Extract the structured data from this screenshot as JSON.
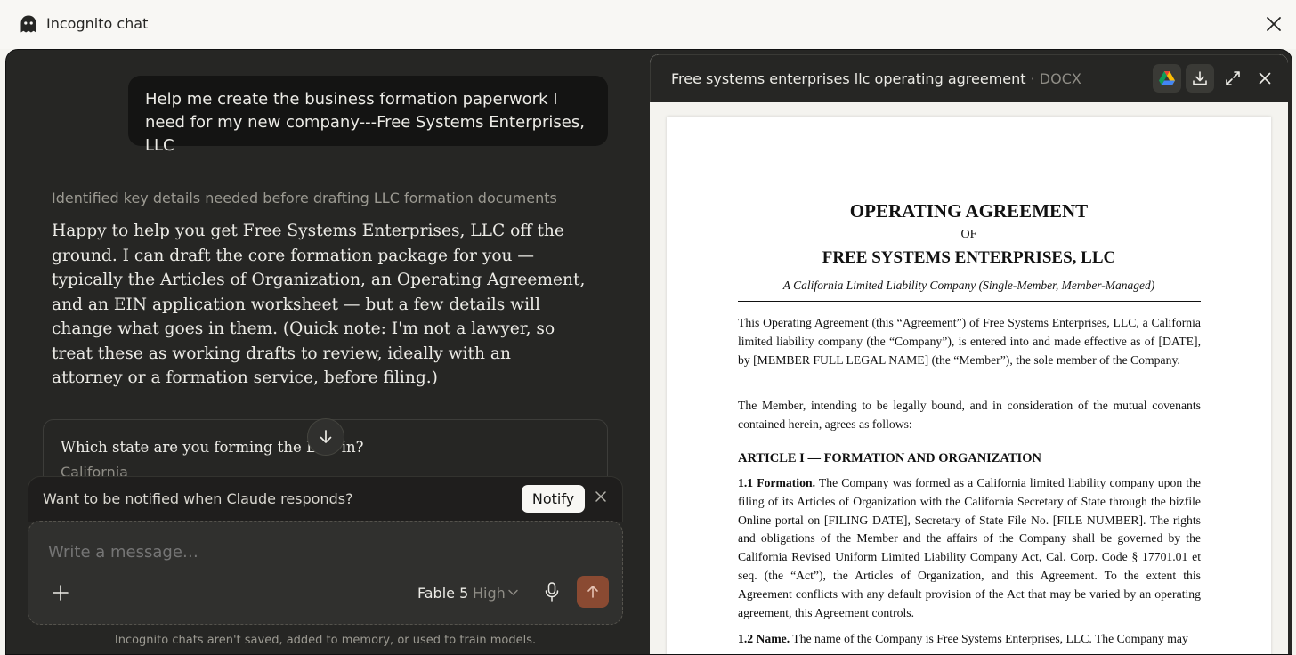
{
  "topbar": {
    "title": "Incognito chat"
  },
  "chat": {
    "user_message": "Help me create the business formation paperwork I need for my new company---Free Systems Enterprises, LLC",
    "thinking_summary": "Identified key details needed before drafting LLC formation documents",
    "assistant_reply": "Happy to help you get Free Systems Enterprises, LLC off the ground. I can draft the core formation package for you — typically the Articles of Organization, an Operating Agreement, and an EIN application worksheet — but a few details will change what goes in them. (Quick note: I'm not a lawyer, so treat these as working drafts to review, ideally with an attorney or a formation service, before filing.)",
    "question_card": {
      "question": "Which state are you forming the LLC in?",
      "answer": "California"
    }
  },
  "notify": {
    "text": "Want to be notified when Claude responds?",
    "button": "Notify"
  },
  "composer": {
    "placeholder": "Write a message…",
    "model": "Fable 5",
    "effort": "High"
  },
  "disclaimer": "Incognito chats aren't saved, added to memory, or used to train models.",
  "document": {
    "filename": "Free systems enterprises llc operating agreement",
    "filetype": " · DOCX",
    "title": "OPERATING AGREEMENT",
    "of": "OF",
    "company": "FREE SYSTEMS ENTERPRISES, LLC",
    "subtitle": "A California Limited Liability Company (Single-Member, Member-Managed)",
    "para1": "This Operating Agreement (this “Agreement”) of Free Systems Enterprises, LLC, a California limited liability company (the “Company”), is entered into and made effective as of [DATE], by [MEMBER FULL LEGAL NAME] (the “Member”), the sole member of the Company.",
    "para2": "The Member, intending to be legally bound, and in consideration of the mutual covenants contained herein, agrees as follows:",
    "article1": "ARTICLE I — FORMATION AND ORGANIZATION",
    "sec11_label": "1.1 Formation.",
    "sec11_text": " The Company was formed as a California limited liability company upon the filing of its Articles of Organization with the California Secretary of State through the bizfile Online portal on [FILING DATE], Secretary of State File No. [FILE NUMBER]. The rights and obligations of the Member and the affairs of the Company shall be governed by the California Revised Uniform Limited Liability Company Act, Cal. Corp. Code § 17701.01 et seq. (the “Act”), the Articles of Organization, and this Agreement. To the extent this Agreement conflicts with any default provision of the Act that may be varied by an operating agreement, this Agreement controls.",
    "sec12_label": "1.2 Name.",
    "sec12_text": " The name of the Company is Free Systems Enterprises, LLC. The Company may"
  },
  "colors": {
    "panel_bg": "#262624",
    "bubble_bg": "#141413",
    "send_button": "#8a4a32",
    "app_bg": "#f4f3ef"
  }
}
